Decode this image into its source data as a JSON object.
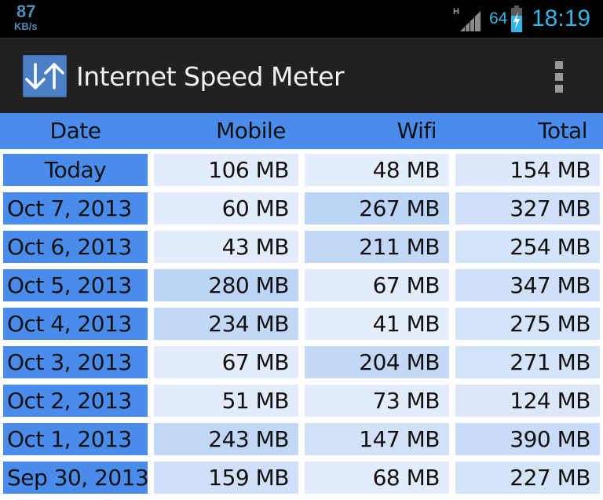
{
  "status_bar": {
    "speed_value": "87",
    "speed_unit": "KB/s",
    "network_type": "H",
    "signal_icon": "signal-bars-icon",
    "battery_percent": "64",
    "battery_icon": "battery-charging-icon",
    "time": "18:19",
    "accent_color": "#33b5e5"
  },
  "action_bar": {
    "app_icon": "download-upload-arrows-icon",
    "title": "Internet Speed Meter",
    "menu_icon": "overflow-menu-icon"
  },
  "table": {
    "header_color": "#4a8ceb",
    "columns": [
      "Date",
      "Mobile",
      "Wifi",
      "Total"
    ],
    "rows": [
      {
        "date": "Today",
        "mobile": "106 MB",
        "wifi": "48 MB",
        "total": "154 MB"
      },
      {
        "date": "Oct 7, 2013",
        "mobile": "60 MB",
        "wifi": "267 MB",
        "total": "327 MB"
      },
      {
        "date": "Oct 6, 2013",
        "mobile": "43 MB",
        "wifi": "211 MB",
        "total": "254 MB"
      },
      {
        "date": "Oct 5, 2013",
        "mobile": "280 MB",
        "wifi": "67 MB",
        "total": "347 MB"
      },
      {
        "date": "Oct 4, 2013",
        "mobile": "234 MB",
        "wifi": "41 MB",
        "total": "275 MB"
      },
      {
        "date": "Oct 3, 2013",
        "mobile": "67 MB",
        "wifi": "204 MB",
        "total": "271 MB"
      },
      {
        "date": "Oct 2, 2013",
        "mobile": "51 MB",
        "wifi": "73 MB",
        "total": "124 MB"
      },
      {
        "date": "Oct 1, 2013",
        "mobile": "243 MB",
        "wifi": "147 MB",
        "total": "390 MB"
      },
      {
        "date": "Sep 30, 2013",
        "mobile": "159 MB",
        "wifi": "68 MB",
        "total": "227 MB"
      }
    ],
    "shades": {
      "light": "#e2ecfb",
      "medium": "#cfe0f8",
      "strong": "#bcd5f6"
    }
  }
}
